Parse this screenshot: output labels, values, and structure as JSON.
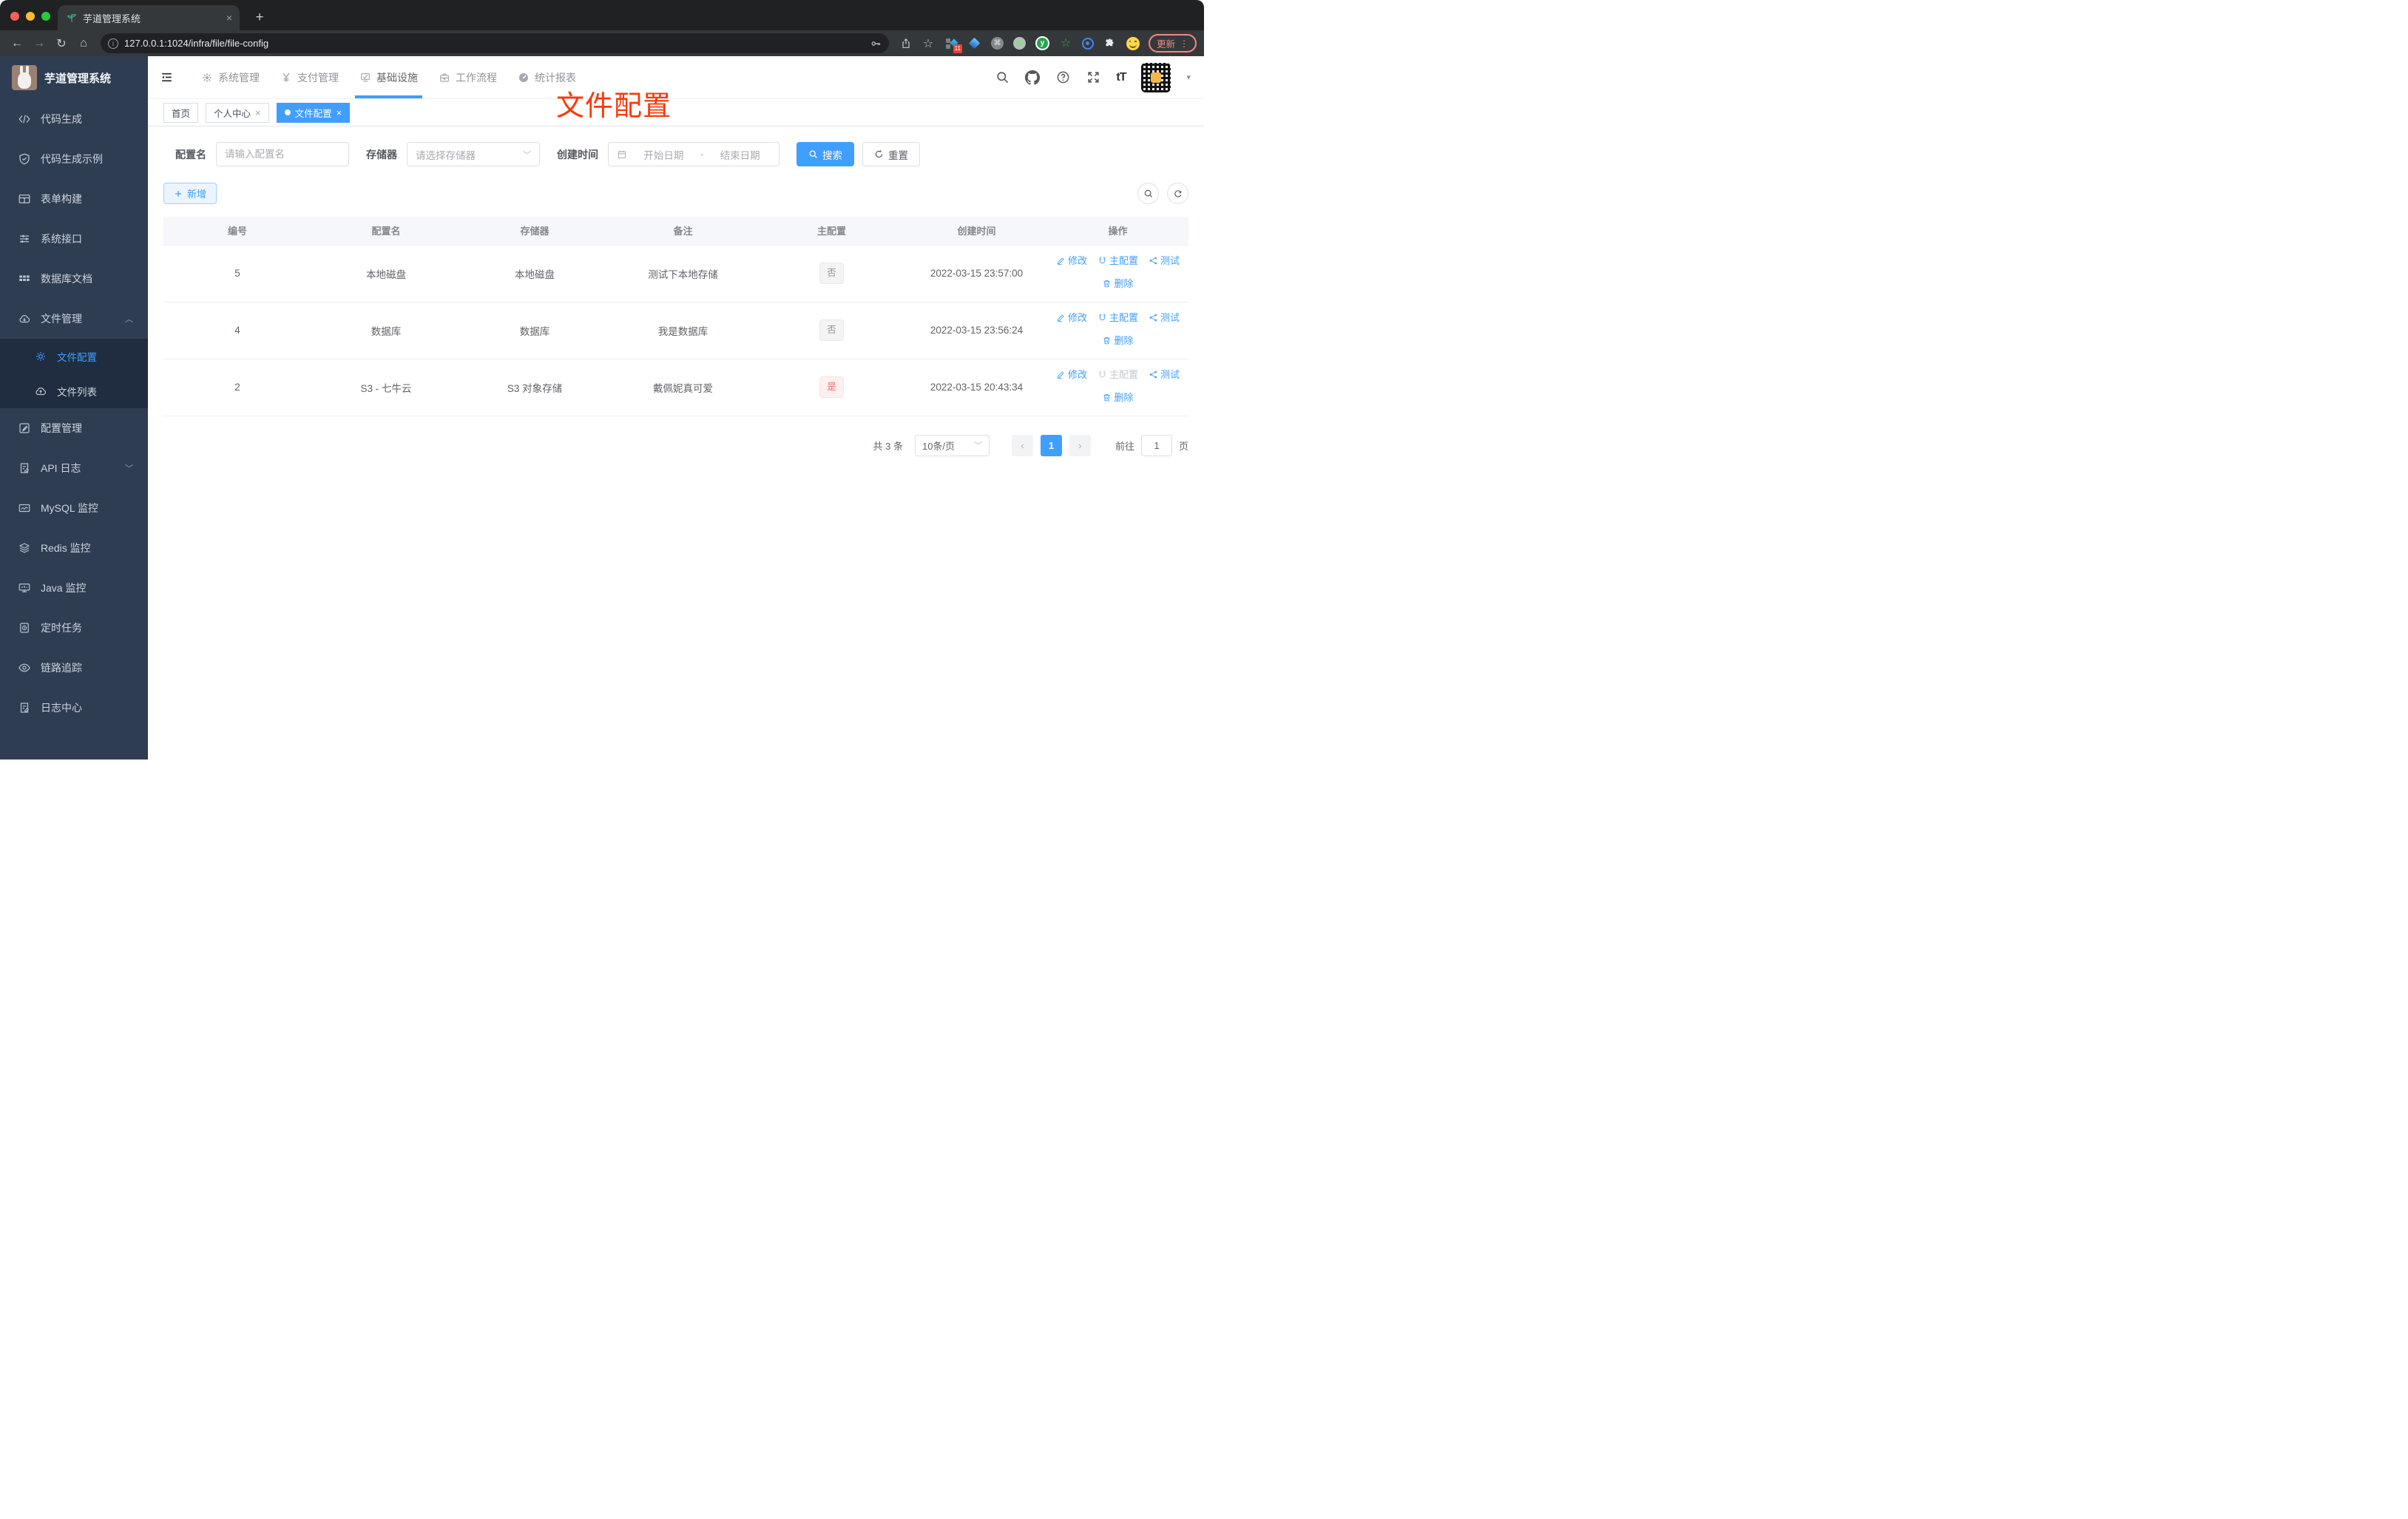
{
  "browser": {
    "tab_title": "芋道管理系统",
    "tab_close": "×",
    "new_tab": "+",
    "back": "←",
    "forward": "→",
    "reload": "↻",
    "home": "⌂",
    "info": "i",
    "url": "127.0.0.1:1024/infra/file/file-config",
    "star": "☆",
    "cmd_glyph": "⌘",
    "ext_y_letter": "y",
    "ext_star_glyph": "☆",
    "ext_badge": "11",
    "update_label": "更新",
    "update_dots": "⋮"
  },
  "app": {
    "logo_title": "芋道管理系统",
    "sidebar": {
      "items": [
        {
          "label": "代码生成"
        },
        {
          "label": "代码生成示例"
        },
        {
          "label": "表单构建"
        },
        {
          "label": "系统接口"
        },
        {
          "label": "数据库文档"
        },
        {
          "label": "文件管理",
          "chevron": "︿",
          "children": [
            {
              "label": "文件配置"
            },
            {
              "label": "文件列表"
            }
          ]
        },
        {
          "label": "配置管理"
        },
        {
          "label": "API 日志",
          "chevron": "﹀"
        },
        {
          "label": "MySQL 监控"
        },
        {
          "label": "Redis 监控"
        },
        {
          "label": "Java 监控"
        },
        {
          "label": "定时任务"
        },
        {
          "label": "链路追踪"
        },
        {
          "label": "日志中心"
        }
      ]
    },
    "topnav": {
      "items": [
        {
          "label": "系统管理"
        },
        {
          "label": "支付管理"
        },
        {
          "label": "基础设施"
        },
        {
          "label": "工作流程"
        },
        {
          "label": "统计报表"
        }
      ]
    },
    "header_tools": {
      "font_size_label": "tT",
      "avatar_caret": "▾"
    },
    "tabs": [
      {
        "label": "首页"
      },
      {
        "label": "个人中心",
        "close": "×"
      },
      {
        "label": "文件配置",
        "close": "×"
      }
    ],
    "annotation": "文件配置",
    "filter": {
      "name_label": "配置名",
      "name_placeholder": "请输入配置名",
      "storage_label": "存储器",
      "storage_placeholder": "请选择存储器",
      "time_label": "创建时间",
      "start_placeholder": "开始日期",
      "range_separator": "-",
      "end_placeholder": "结束日期",
      "search_label": "搜索",
      "reset_label": "重置"
    },
    "toolbar": {
      "add_label": "新增"
    },
    "table": {
      "headers": [
        "编号",
        "配置名",
        "存储器",
        "备注",
        "主配置",
        "创建时间",
        "操作"
      ],
      "actions": {
        "edit": "修改",
        "master": "主配置",
        "test": "测试",
        "delete": "删除"
      },
      "rows": [
        {
          "id": "5",
          "name": "本地磁盘",
          "storage": "本地磁盘",
          "remark": "测试下本地存储",
          "master": "否",
          "created": "2022-03-15 23:57:00"
        },
        {
          "id": "4",
          "name": "数据库",
          "storage": "数据库",
          "remark": "我是数据库",
          "master": "否",
          "created": "2022-03-15 23:56:24"
        },
        {
          "id": "2",
          "name": "S3 - 七牛云",
          "storage": "S3 对象存储",
          "remark": "戴佩妮真可爱",
          "master": "是",
          "created": "2022-03-15 20:43:34"
        }
      ]
    },
    "pagination": {
      "total": "共 3 条",
      "page_size": "10条/页",
      "prev": "‹",
      "page": "1",
      "next": "›",
      "jump_label": "前往",
      "jump_value": "1",
      "jump_suffix": "页"
    }
  }
}
